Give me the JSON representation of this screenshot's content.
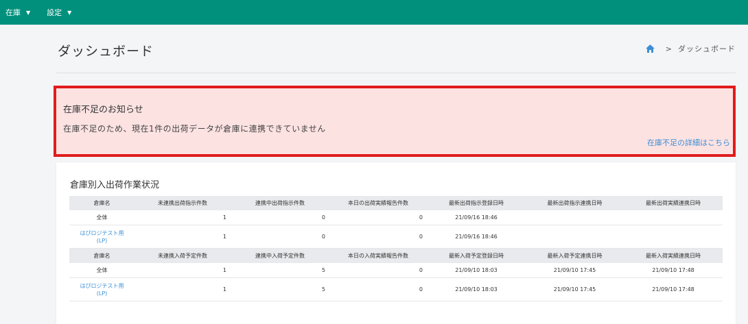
{
  "nav": {
    "menus": [
      {
        "label": "在庫"
      },
      {
        "label": "設定"
      }
    ]
  },
  "header": {
    "title": "ダッシュボード",
    "breadcrumb": "ダッシュボード"
  },
  "alert": {
    "title": "在庫不足のお知らせ",
    "body": "在庫不足のため、現在1件の出荷データが倉庫に連携できていません",
    "link": "在庫不足の詳細はこちら"
  },
  "status": {
    "title": "倉庫別入出荷作業状況",
    "shipping": {
      "headers": [
        "倉庫名",
        "未連携出荷指示件数",
        "連携中出荷指示件数",
        "本日の出荷実績報告件数",
        "最新出荷指示登録日時",
        "最新出荷指示連携日時",
        "最新出荷実績連携日時"
      ],
      "rows": [
        {
          "name": "全体",
          "unsynced": "1",
          "syncing": "0",
          "today": "0",
          "registered": "21/09/16 18:46",
          "synced": "",
          "result": ""
        },
        {
          "name": "はぴロジテスト用\n(LP)",
          "unsynced": "1",
          "syncing": "0",
          "today": "0",
          "registered": "21/09/16 18:46",
          "synced": "",
          "result": ""
        }
      ]
    },
    "receiving": {
      "headers": [
        "倉庫名",
        "未連携入荷予定件数",
        "連携中入荷予定件数",
        "本日の入荷実績報告件数",
        "最新入荷予定登録日時",
        "最新入荷予定連携日時",
        "最新入荷実績連携日時"
      ],
      "rows": [
        {
          "name": "全体",
          "unsynced": "1",
          "syncing": "5",
          "today": "0",
          "registered": "21/09/10 18:03",
          "synced": "21/09/10 17:45",
          "result": "21/09/10 17:48"
        },
        {
          "name": "はぴロジテスト用\n(LP)",
          "unsynced": "1",
          "syncing": "5",
          "today": "0",
          "registered": "21/09/10 18:03",
          "synced": "21/09/10 17:45",
          "result": "21/09/10 17:48"
        }
      ]
    }
  },
  "colors": {
    "topbar": "#00907c",
    "alert_bg": "#fde2e2",
    "alert_border": "#e01c1c",
    "link": "#3a8fd6"
  }
}
